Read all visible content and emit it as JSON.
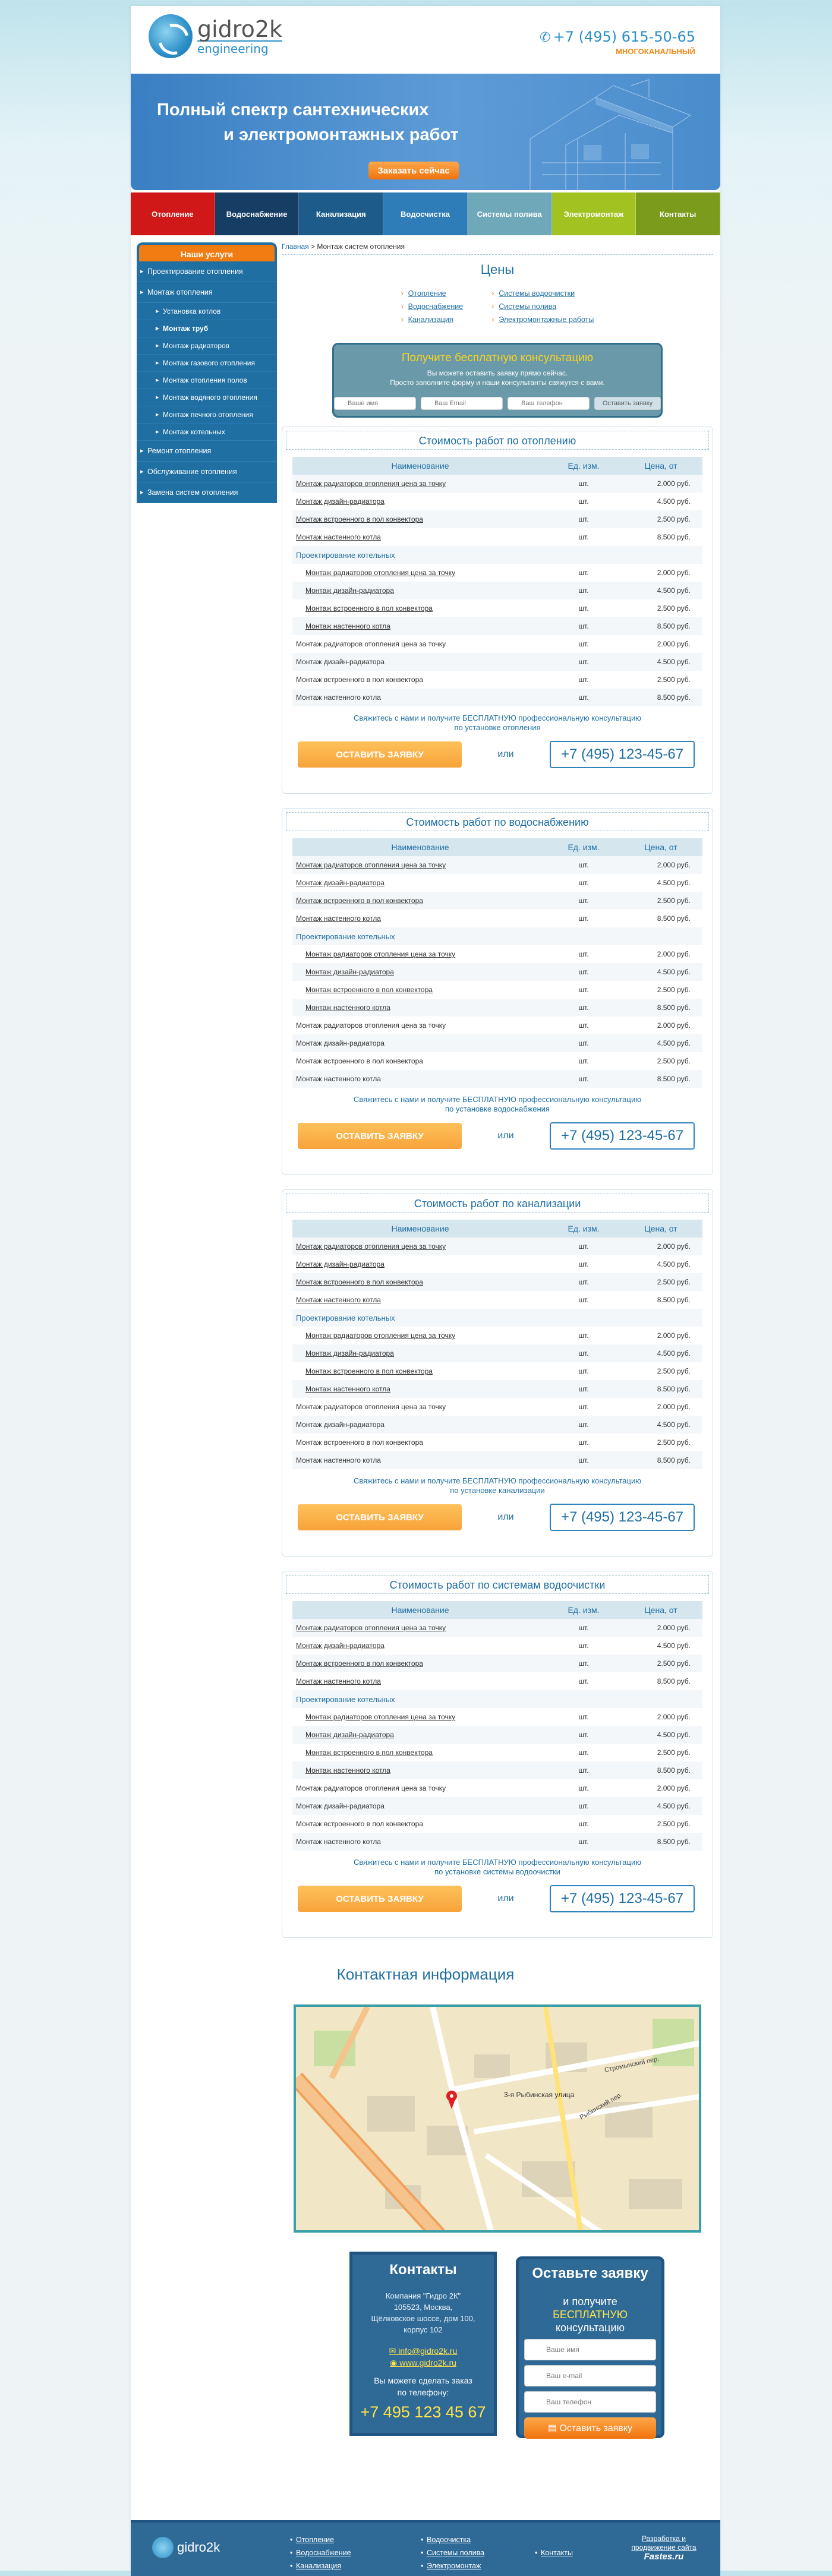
{
  "header": {
    "logo_name": "gidro2k",
    "logo_sub": "engineering",
    "phone": "+7 (495) 615-50-65",
    "phone_note": "многоканальный"
  },
  "banner": {
    "line1": "Полный спектр сантехнических",
    "line2": "и электромонтажных работ",
    "button": "Заказать сейчас"
  },
  "nav": [
    {
      "label": "Отопление",
      "color": "#d01818"
    },
    {
      "label": "Водоснабжение",
      "color": "#163d63"
    },
    {
      "label": "Канализация",
      "color": "#1d5c8a"
    },
    {
      "label": "Водосчистка",
      "color": "#2e7db8"
    },
    {
      "label": "Системы полива",
      "color": "#6fa9b9"
    },
    {
      "label": "Электромонтаж",
      "color": "#a2c222"
    },
    {
      "label": "Контакты",
      "color": "#7a9b1c"
    }
  ],
  "sidebar": {
    "title": "Наши услуги",
    "items": [
      {
        "label": "Проектирование отопления",
        "type": "top"
      },
      {
        "label": "Монтаж отопления",
        "type": "top"
      },
      {
        "label": "Установка котлов",
        "type": "sub"
      },
      {
        "label": "Монтаж труб",
        "type": "sub-cur"
      },
      {
        "label": "Монтаж радиаторов",
        "type": "sub"
      },
      {
        "label": "Монтаж газового отопления",
        "type": "sub"
      },
      {
        "label": "Монтаж отопления полов",
        "type": "sub"
      },
      {
        "label": "Монтаж водяного отопления",
        "type": "sub"
      },
      {
        "label": "Монтаж печного отопления",
        "type": "sub"
      },
      {
        "label": "Монтаж котельных",
        "type": "sub"
      },
      {
        "label": "Ремонт отопления",
        "type": "top"
      },
      {
        "label": "Обслуживание отопления",
        "type": "top"
      },
      {
        "label": "Замена систем отопления",
        "type": "top"
      }
    ]
  },
  "breadcrumb": {
    "home": "Главная",
    "sep": " > ",
    "current": "Монтаж систем отопления"
  },
  "prices": {
    "title": "Цены",
    "links_left": [
      "Отопление",
      "Водоснабжение",
      "Канализация"
    ],
    "links_right": [
      "Системы водоочистки",
      "Системы полива",
      "Электромонтажные работы"
    ]
  },
  "consult": {
    "title": "Получите бесплатную консультацию",
    "text1": "Вы можете оставить заявку прямо сейчас.",
    "text2": "Просто заполните форму и наши консультанты свяжутся с вами.",
    "ph_name": "Ваше имя",
    "ph_email": "Ваш Email",
    "ph_phone": "Ваш телефон",
    "button": "Оставить заявку"
  },
  "table_head": {
    "name": "Наименование",
    "unit": "Ед. изм.",
    "price": "Цена, от"
  },
  "rows": [
    {
      "n": "Монтаж радиаторов отопления цена за точку",
      "u": "шт.",
      "v": "2.000 руб.",
      "k": ""
    },
    {
      "n": "Монтаж дизайн-радиатора",
      "u": "шт.",
      "v": "4.500 руб.",
      "k": ""
    },
    {
      "n": "Монтаж встроенного в пол конвектора",
      "u": "шт.",
      "v": "2.500 руб.",
      "k": ""
    },
    {
      "n": "Монтаж настенного котла",
      "u": "шт.",
      "v": "8.500 руб.",
      "k": ""
    },
    {
      "n": "Проектирование котельных",
      "u": "",
      "v": "",
      "k": "g"
    },
    {
      "n": "Монтаж радиаторов отопления цена за точку",
      "u": "шт.",
      "v": "2.000 руб.",
      "k": "i"
    },
    {
      "n": "Монтаж дизайн-радиатора",
      "u": "шт.",
      "v": "4.500 руб.",
      "k": "i"
    },
    {
      "n": "Монтаж встроенного в пол конвектора",
      "u": "шт.",
      "v": "2.500 руб.",
      "k": "i"
    },
    {
      "n": "Монтаж настенного котла",
      "u": "шт.",
      "v": "8.500 руб.",
      "k": "i"
    },
    {
      "n": "Монтаж радиаторов отопления цена за точку",
      "u": "шт.",
      "v": "2.000 руб.",
      "k": "p"
    },
    {
      "n": "Монтаж дизайн-радиатора",
      "u": "шт.",
      "v": "4.500 руб.",
      "k": "p"
    },
    {
      "n": "Монтаж встроенного в пол конвектора",
      "u": "шт.",
      "v": "2.500 руб.",
      "k": "p"
    },
    {
      "n": "Монтаж настенного котла",
      "u": "шт.",
      "v": "8.500 руб.",
      "k": "p"
    }
  ],
  "blocks": [
    {
      "title": "Стоимость работ по отоплению",
      "note1": "Свяжитесь с нами и получите БЕСПЛАТНУЮ профессиональную консультацию",
      "note2": "по установке отопления"
    },
    {
      "title": "Стоимость работ по водоснабжению",
      "note1": "Свяжитесь с нами и получите БЕСПЛАТНУЮ профессиональную консультацию",
      "note2": "по установке водоснабжения"
    },
    {
      "title": "Стоимость работ по канализации",
      "note1": "Свяжитесь с нами и получите БЕСПЛАТНУЮ профессиональную консультацию",
      "note2": "по установке канализации"
    },
    {
      "title": "Стоимость работ по системам водоочистки",
      "note1": "Свяжитесь с нами и получите БЕСПЛАТНУЮ профессиональную консультацию",
      "note2": "по установке системы водоочистки"
    }
  ],
  "cta": {
    "button": "ОСТАВИТЬ ЗАЯВКУ",
    "or": "или",
    "phone": "+7 (495) 123-45-67"
  },
  "contacts": {
    "title": "Контактная информация",
    "map_street1": "3-я Рыбинская улица",
    "map_street2": "Рыбинский пер.",
    "map_street3": "Стромынский пер.",
    "box_title": "Контакты",
    "addr1": "Компания \"Гидро 2К\"",
    "addr2": "105523, Москва,",
    "addr3": "Щёлковское шоссе, дом 100,",
    "addr4": "корпус 102",
    "email": "info@gidro2k.ru",
    "site": "www.gidro2k.ru",
    "ask1": "Вы можете сделать заказ",
    "ask2": "по телефону:",
    "big_phone": "+7 495 123 45 67"
  },
  "order": {
    "title": "Оставьте заявку",
    "t1": "и получите",
    "t2": "БЕСПЛАТНУЮ",
    "t3": "консультацию",
    "ph_name": "Ваше имя",
    "ph_email": "Ваш e-mail",
    "ph_phone": "Ваш телефон",
    "button": "Оставить заявку"
  },
  "footer": {
    "logo": "gidro2k",
    "col1": [
      "Отопление",
      "Водоснабжение",
      "Канализация"
    ],
    "col2": [
      "Водоочистка",
      "Системы полива",
      "Электромонтаж"
    ],
    "col3": [
      "Контакты"
    ],
    "dev1": "Разработка и",
    "dev2": "продвижение сайта",
    "dev3": "Fastes.ru"
  }
}
